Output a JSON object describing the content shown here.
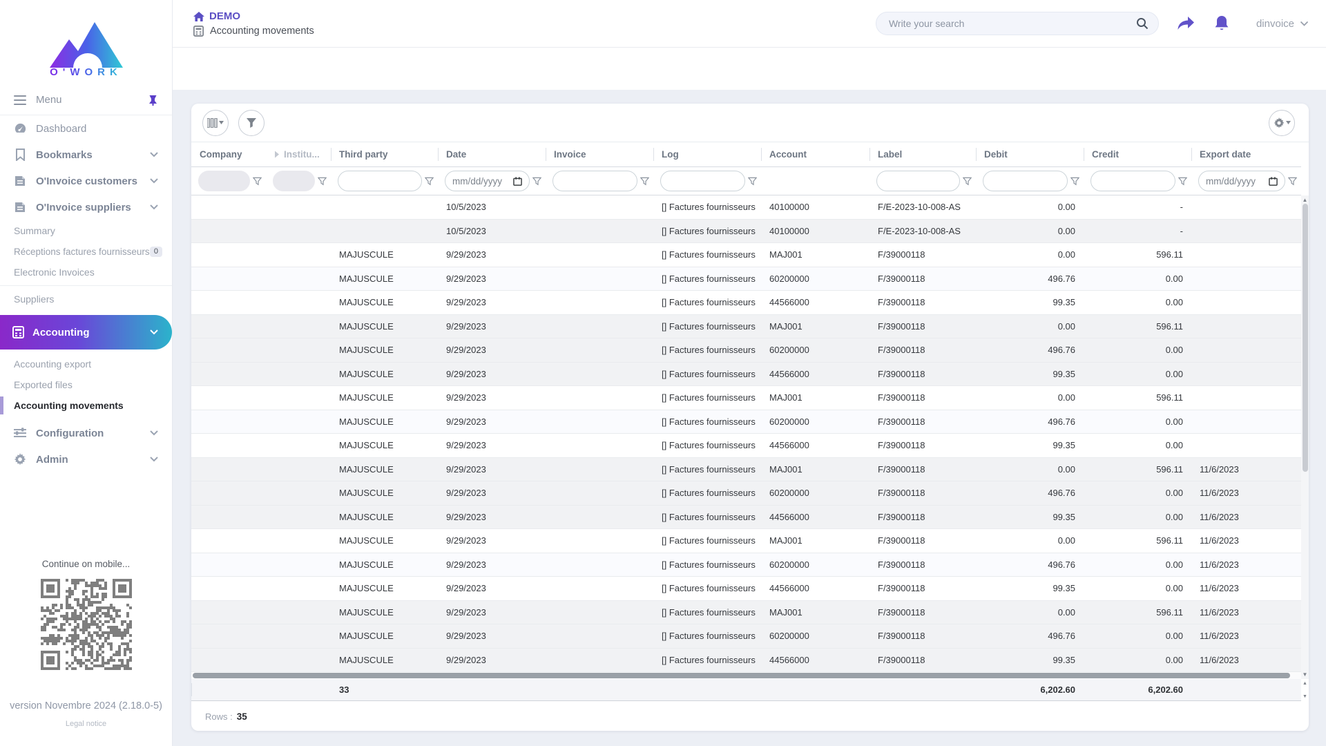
{
  "brand": {
    "name": "O'WORK"
  },
  "header": {
    "app_title": "DEMO",
    "breadcrumb": "Accounting movements",
    "search_placeholder": "Write your search",
    "user": "dinvoice"
  },
  "sidebar": {
    "menu_label": "Menu",
    "items": {
      "dashboard": "Dashboard",
      "bookmarks": "Bookmarks",
      "oinvoice_customers": "O'Invoice customers",
      "oinvoice_suppliers": "O'Invoice suppliers",
      "summary": "Summary",
      "receptions": "Réceptions factures fournisseurs",
      "receptions_badge": "0",
      "electronic_invoices": "Electronic Invoices",
      "suppliers": "Suppliers",
      "accounting": "Accounting",
      "accounting_export": "Accounting export",
      "exported_files": "Exported files",
      "accounting_movements": "Accounting movements",
      "configuration": "Configuration",
      "admin": "Admin"
    },
    "mobile_hint": "Continue on mobile...",
    "version": "version Novembre 2024 (2.18.0-5)",
    "legal": "Legal notice"
  },
  "table": {
    "columns": [
      {
        "key": "company",
        "label": "Company",
        "align": "left",
        "filter": "disabled"
      },
      {
        "key": "institution",
        "label": "Institu...",
        "align": "left",
        "filter": "disabled",
        "dim": true
      },
      {
        "key": "third_party",
        "label": "Third party",
        "align": "left",
        "filter": "text"
      },
      {
        "key": "date",
        "label": "Date",
        "align": "left",
        "filter": "date"
      },
      {
        "key": "invoice",
        "label": "Invoice",
        "align": "left",
        "filter": "text"
      },
      {
        "key": "log",
        "label": "Log",
        "align": "left",
        "filter": "text"
      },
      {
        "key": "account",
        "label": "Account",
        "align": "left",
        "filter": "none"
      },
      {
        "key": "label",
        "label": "Label",
        "align": "left",
        "filter": "text"
      },
      {
        "key": "debit",
        "label": "Debit",
        "align": "right",
        "filter": "text"
      },
      {
        "key": "credit",
        "label": "Credit",
        "align": "right",
        "filter": "text"
      },
      {
        "key": "export_date",
        "label": "Export date",
        "align": "left",
        "filter": "date"
      }
    ],
    "date_placeholder": "mm/dd/yyyy",
    "rows": [
      {
        "shade": "white",
        "cells": [
          "",
          "",
          "",
          "10/5/2023",
          "",
          "[] Factures fournisseurs",
          "40100000",
          "F/E-2023-10-008-AS",
          "0.00",
          "-",
          ""
        ]
      },
      {
        "shade": "gray",
        "cells": [
          "",
          "",
          "",
          "10/5/2023",
          "",
          "[] Factures fournisseurs",
          "40100000",
          "F/E-2023-10-008-AS",
          "0.00",
          "-",
          ""
        ]
      },
      {
        "shade": "white",
        "cells": [
          "",
          "",
          "MAJUSCULE",
          "9/29/2023",
          "",
          "[] Factures fournisseurs",
          "MAJ001",
          "F/39000118",
          "0.00",
          "596.11",
          ""
        ]
      },
      {
        "shade": "tint",
        "cells": [
          "",
          "",
          "MAJUSCULE",
          "9/29/2023",
          "",
          "[] Factures fournisseurs",
          "60200000",
          "F/39000118",
          "496.76",
          "0.00",
          ""
        ]
      },
      {
        "shade": "white",
        "cells": [
          "",
          "",
          "MAJUSCULE",
          "9/29/2023",
          "",
          "[] Factures fournisseurs",
          "44566000",
          "F/39000118",
          "99.35",
          "0.00",
          ""
        ]
      },
      {
        "shade": "gray",
        "cells": [
          "",
          "",
          "MAJUSCULE",
          "9/29/2023",
          "",
          "[] Factures fournisseurs",
          "MAJ001",
          "F/39000118",
          "0.00",
          "596.11",
          ""
        ]
      },
      {
        "shade": "gray",
        "cells": [
          "",
          "",
          "MAJUSCULE",
          "9/29/2023",
          "",
          "[] Factures fournisseurs",
          "60200000",
          "F/39000118",
          "496.76",
          "0.00",
          ""
        ]
      },
      {
        "shade": "gray",
        "cells": [
          "",
          "",
          "MAJUSCULE",
          "9/29/2023",
          "",
          "[] Factures fournisseurs",
          "44566000",
          "F/39000118",
          "99.35",
          "0.00",
          ""
        ]
      },
      {
        "shade": "white",
        "cells": [
          "",
          "",
          "MAJUSCULE",
          "9/29/2023",
          "",
          "[] Factures fournisseurs",
          "MAJ001",
          "F/39000118",
          "0.00",
          "596.11",
          ""
        ]
      },
      {
        "shade": "tint",
        "cells": [
          "",
          "",
          "MAJUSCULE",
          "9/29/2023",
          "",
          "[] Factures fournisseurs",
          "60200000",
          "F/39000118",
          "496.76",
          "0.00",
          ""
        ]
      },
      {
        "shade": "white",
        "cells": [
          "",
          "",
          "MAJUSCULE",
          "9/29/2023",
          "",
          "[] Factures fournisseurs",
          "44566000",
          "F/39000118",
          "99.35",
          "0.00",
          ""
        ]
      },
      {
        "shade": "gray",
        "cells": [
          "",
          "",
          "MAJUSCULE",
          "9/29/2023",
          "",
          "[] Factures fournisseurs",
          "MAJ001",
          "F/39000118",
          "0.00",
          "596.11",
          "11/6/2023"
        ]
      },
      {
        "shade": "gray",
        "cells": [
          "",
          "",
          "MAJUSCULE",
          "9/29/2023",
          "",
          "[] Factures fournisseurs",
          "60200000",
          "F/39000118",
          "496.76",
          "0.00",
          "11/6/2023"
        ]
      },
      {
        "shade": "gray",
        "cells": [
          "",
          "",
          "MAJUSCULE",
          "9/29/2023",
          "",
          "[] Factures fournisseurs",
          "44566000",
          "F/39000118",
          "99.35",
          "0.00",
          "11/6/2023"
        ]
      },
      {
        "shade": "white",
        "cells": [
          "",
          "",
          "MAJUSCULE",
          "9/29/2023",
          "",
          "[] Factures fournisseurs",
          "MAJ001",
          "F/39000118",
          "0.00",
          "596.11",
          "11/6/2023"
        ]
      },
      {
        "shade": "tint",
        "cells": [
          "",
          "",
          "MAJUSCULE",
          "9/29/2023",
          "",
          "[] Factures fournisseurs",
          "60200000",
          "F/39000118",
          "496.76",
          "0.00",
          "11/6/2023"
        ]
      },
      {
        "shade": "white",
        "cells": [
          "",
          "",
          "MAJUSCULE",
          "9/29/2023",
          "",
          "[] Factures fournisseurs",
          "44566000",
          "F/39000118",
          "99.35",
          "0.00",
          "11/6/2023"
        ]
      },
      {
        "shade": "gray",
        "cells": [
          "",
          "",
          "MAJUSCULE",
          "9/29/2023",
          "",
          "[] Factures fournisseurs",
          "MAJ001",
          "F/39000118",
          "0.00",
          "596.11",
          "11/6/2023"
        ]
      },
      {
        "shade": "gray",
        "cells": [
          "",
          "",
          "MAJUSCULE",
          "9/29/2023",
          "",
          "[] Factures fournisseurs",
          "60200000",
          "F/39000118",
          "496.76",
          "0.00",
          "11/6/2023"
        ]
      },
      {
        "shade": "gray",
        "cells": [
          "",
          "",
          "MAJUSCULE",
          "9/29/2023",
          "",
          "[] Factures fournisseurs",
          "44566000",
          "F/39000118",
          "99.35",
          "0.00",
          "11/6/2023"
        ]
      }
    ],
    "totals": {
      "third_party": "33",
      "debit": "6,202.60",
      "credit": "6,202.60"
    },
    "rows_label": "Rows :",
    "rows_count": "35"
  },
  "colors": {
    "accent_purple": "#5b4fc4",
    "gradient_start": "#8a28c9",
    "gradient_end": "#2bb3cb",
    "content_bg": "#eceff5"
  }
}
